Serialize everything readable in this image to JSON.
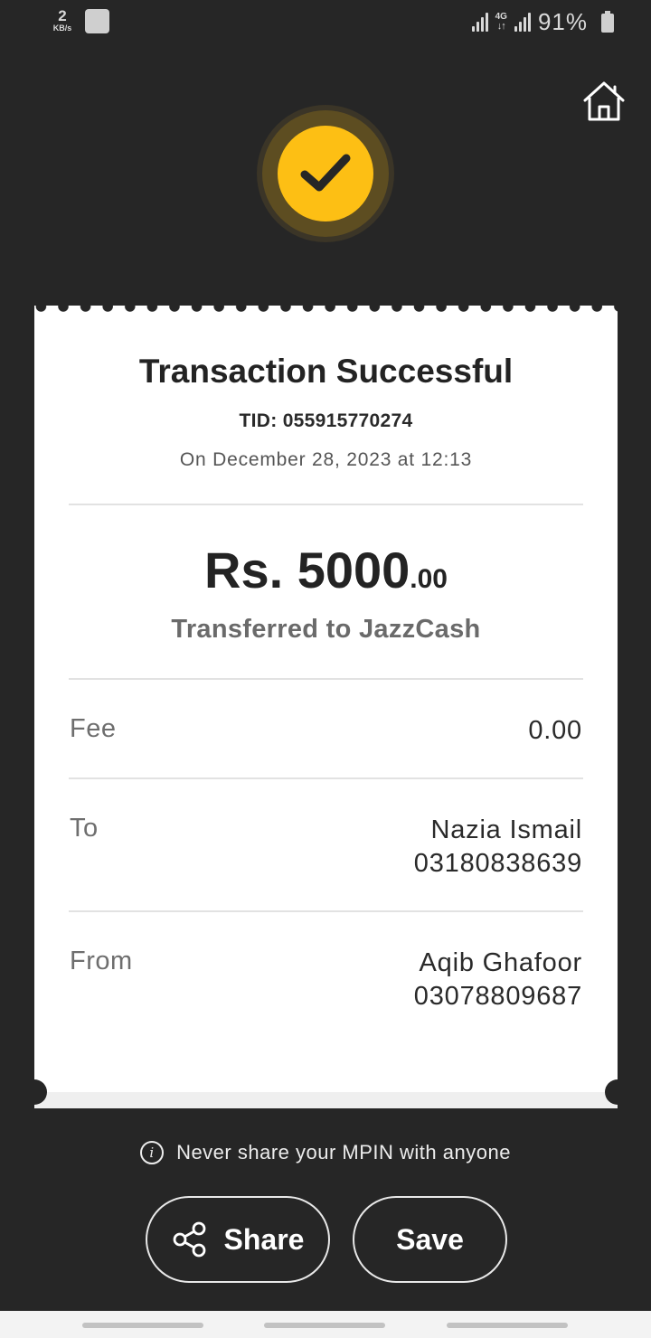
{
  "status_bar": {
    "speed_value": "2",
    "speed_unit": "KB/s",
    "network_type": "4G",
    "battery_percent": "91%"
  },
  "receipt": {
    "title": "Transaction Successful",
    "tid": "TID: 055915770274",
    "datetime": "On December 28, 2023 at 12:13",
    "amount_main": "Rs. 5000",
    "amount_decimal": ".00",
    "transfer_desc": "Transferred to JazzCash",
    "fee_label": "Fee",
    "fee_value": "0.00",
    "to_label": "To",
    "to_name": "Nazia Ismail",
    "to_number": "03180838639",
    "from_label": "From",
    "from_name": "Aqib Ghafoor",
    "from_number": "03078809687"
  },
  "notice": {
    "text": "Never share your MPIN with anyone",
    "icon": "info-icon"
  },
  "actions": {
    "share_label": "Share",
    "save_label": "Save"
  },
  "colors": {
    "background": "#262626",
    "accent": "#fdbf14",
    "card": "#ffffff"
  }
}
